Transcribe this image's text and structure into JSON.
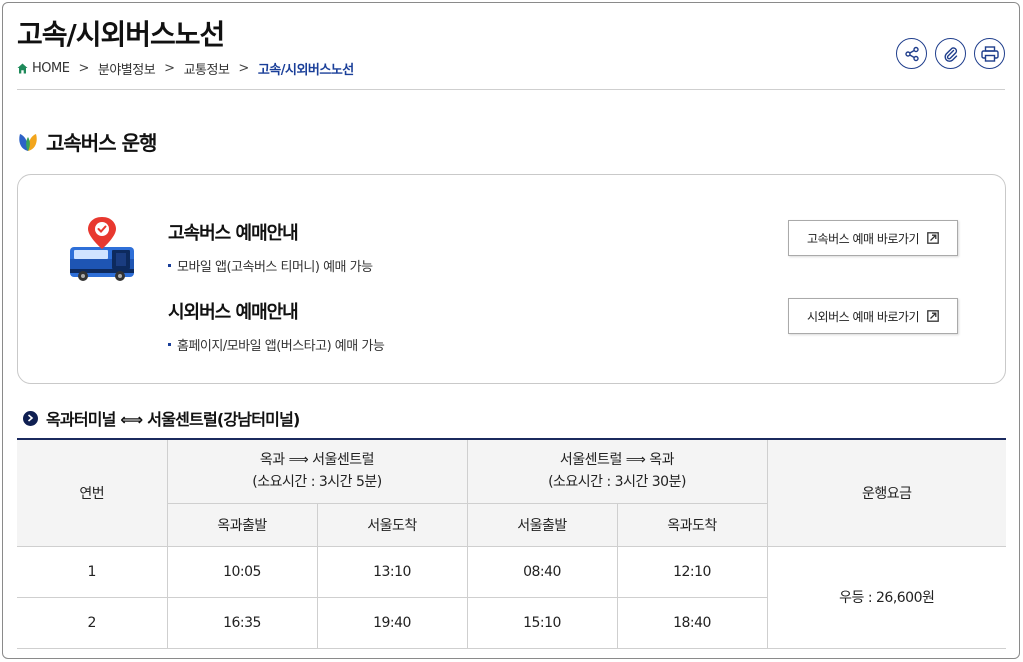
{
  "header": {
    "title": "고속/시외버스노선",
    "breadcrumb": [
      "HOME",
      "분야별정보",
      "교통정보",
      "고속/시외버스노선"
    ],
    "tools": [
      "share-icon",
      "link-icon",
      "print-icon"
    ]
  },
  "section": {
    "title": "고속버스 운행"
  },
  "info": {
    "items": [
      {
        "title": "고속버스 예매안내",
        "desc": "모바일 앱(고속버스 티머니) 예매 가능",
        "button": "고속버스 예매 바로가기"
      },
      {
        "title": "시외버스 예매안내",
        "desc": "홈페이지/모바일 앱(버스타고) 예매 가능",
        "button": "시외버스 예매 바로가기"
      }
    ]
  },
  "route": {
    "title": "옥과터미널 ⟺ 서울센트럴(강남터미널)",
    "table": {
      "col_no": "연번",
      "dir1": {
        "line1": "옥과 ⟹ 서울센트럴",
        "line2": "(소요시간 : 3시간 5분)"
      },
      "dir2": {
        "line1": "서울센트럴 ⟹ 옥과",
        "line2": "(소요시간 : 3시간 30분)"
      },
      "col_fare": "운행요금",
      "sub": [
        "옥과출발",
        "서울도착",
        "서울출발",
        "옥과도착"
      ],
      "rows": [
        {
          "no": "1",
          "t1": "10:05",
          "t2": "13:10",
          "t3": "08:40",
          "t4": "12:10"
        },
        {
          "no": "2",
          "t1": "16:35",
          "t2": "19:40",
          "t3": "15:10",
          "t4": "18:40"
        }
      ],
      "fare": "우등 : 26,600원"
    }
  },
  "colors": {
    "navy": "#1b2a5e",
    "blue": "#1a3f99",
    "home_green": "#1f8a5a"
  }
}
